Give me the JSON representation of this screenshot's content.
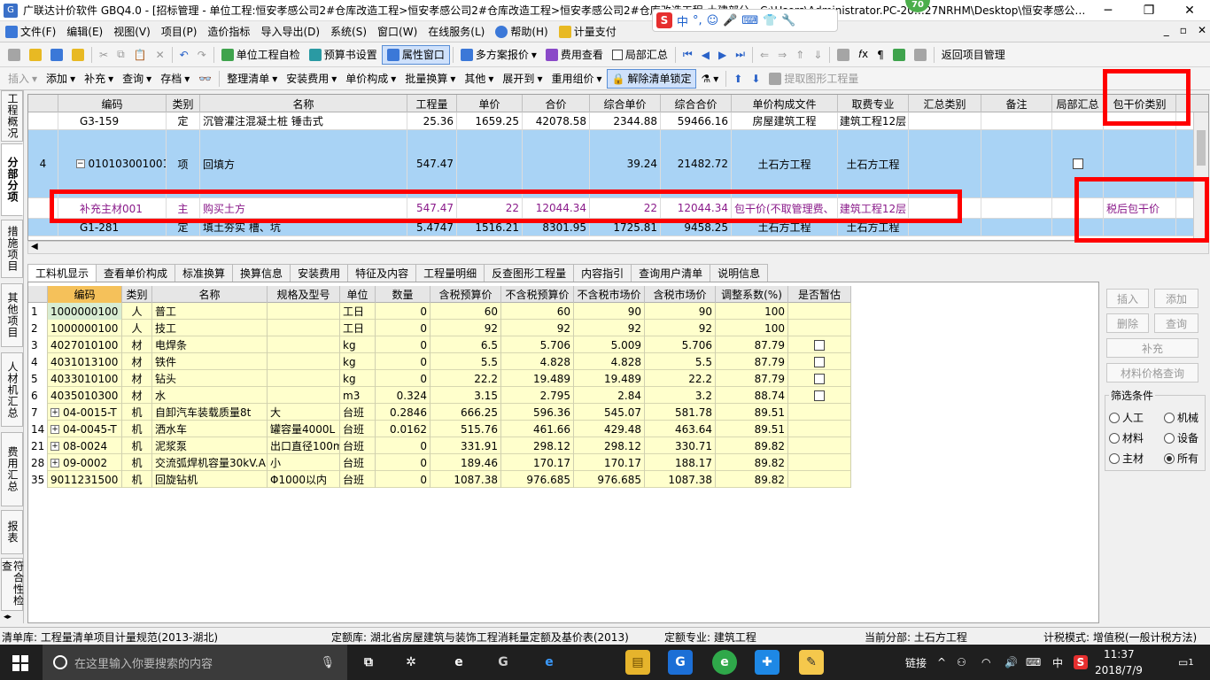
{
  "window": {
    "title": "广联达计价软件 GBQ4.0 - [招标管理 - 单位工程:恒安孝感公司2#仓库改造工程>恒安孝感公司2#仓库改造工程>恒安孝感公司2#仓库改造工程-土建部分 - C:\\Users\\Administrator.PC-20…27NRHM\\Desktop\\恒安孝感公…",
    "minimize": "─",
    "restore": "❐",
    "close": "✕"
  },
  "ime": {
    "logo": "S",
    "mode": "中",
    "punct": "°,"
  },
  "badge": "70",
  "menu": {
    "items": [
      "文件(F)",
      "编辑(E)",
      "视图(V)",
      "项目(P)",
      "造价指标",
      "导入导出(D)",
      "系统(S)",
      "窗口(W)",
      "在线服务(L)",
      "帮助(H)",
      "计量支付"
    ],
    "right": [
      "_",
      "▫",
      "✕"
    ]
  },
  "toolbar1": {
    "self_check": "单位工程自检",
    "budget_setting": "预算书设置",
    "attr_window": "属性窗口",
    "multi_quote": "多方案报价",
    "fee_view": "费用查看",
    "local_summary": "局部汇总",
    "return_project": "返回项目管理"
  },
  "toolbar2": {
    "items": [
      "插入",
      "添加",
      "补充",
      "查询",
      "存档"
    ],
    "items2": [
      "整理清单",
      "安装费用",
      "单价构成",
      "批量换算",
      "其他",
      "展开到",
      "重用组价"
    ],
    "unlock": "解除清单锁定",
    "extract": "提取图形工程量"
  },
  "lefttabs": [
    "工程概况",
    "分部分项",
    "措施项目",
    "其他项目",
    "人材机汇总",
    "费用汇总",
    "报表",
    "符合性检查"
  ],
  "grid1": {
    "columns": [
      "编码",
      "类别",
      "名称",
      "工程量",
      "单价",
      "合价",
      "综合单价",
      "综合合价",
      "单价构成文件",
      "取费专业",
      "汇总类别",
      "备注",
      "局部汇总",
      "包干价类别"
    ],
    "rows": [
      {
        "idx": "",
        "code": "G3-159",
        "type": "定",
        "name": "沉管灌注混凝土桩 锤击式",
        "qty": "25.36",
        "price": "1659.25",
        "total": "42078.58",
        "uprice": "2344.88",
        "utotal": "59466.16",
        "file": "房屋建筑工程",
        "major": "建筑工程12层",
        "pkg": ""
      },
      {
        "idx": "4",
        "code": "010103001001",
        "type": "项",
        "name": "回填方",
        "qty": "547.47",
        "price": "",
        "total": "",
        "uprice": "39.24",
        "utotal": "21482.72",
        "file": "土石方工程",
        "major": "土石方工程",
        "pkg": ""
      },
      {
        "idx": "",
        "code": "补充主材001",
        "type": "主",
        "name": "购买土方",
        "qty": "547.47",
        "price": "22",
        "total": "12044.34",
        "uprice": "22",
        "utotal": "12044.34",
        "file": "包干价(不取管理费、",
        "major": "建筑工程12层",
        "pkg": "税后包干价"
      },
      {
        "idx": "",
        "code": "G1-281",
        "type": "定",
        "name": "填土夯实 槽、坑",
        "qty": "5.4747",
        "price": "1516.21",
        "total": "8301.95",
        "uprice": "1725.81",
        "utotal": "9458.25",
        "file": "土石方工程",
        "major": "土石方工程",
        "pkg": ""
      }
    ]
  },
  "subtabs": [
    "工料机显示",
    "查看单价构成",
    "标准换算",
    "换算信息",
    "安装费用",
    "特征及内容",
    "工程量明细",
    "反查图形工程量",
    "内容指引",
    "查询用户清单",
    "说明信息"
  ],
  "grid2": {
    "columns": [
      "编码",
      "类别",
      "名称",
      "规格及型号",
      "单位",
      "数量",
      "含税预算价",
      "不含税预算价",
      "不含税市场价",
      "含税市场价",
      "调整系数(%)",
      "是否暂估"
    ],
    "rows": [
      {
        "n": "1",
        "plus": false,
        "code": "1000000100",
        "type": "人",
        "name": "普工",
        "spec": "",
        "unit": "工日",
        "qty": "0",
        "p1": "60",
        "p2": "60",
        "p3": "90",
        "p4": "90",
        "coef": "100",
        "chk": false
      },
      {
        "n": "2",
        "plus": false,
        "code": "1000000100",
        "type": "人",
        "name": "技工",
        "spec": "",
        "unit": "工日",
        "qty": "0",
        "p1": "92",
        "p2": "92",
        "p3": "92",
        "p4": "92",
        "coef": "100",
        "chk": false
      },
      {
        "n": "3",
        "plus": false,
        "code": "4027010100",
        "type": "材",
        "name": "电焊条",
        "spec": "",
        "unit": "kg",
        "qty": "0",
        "p1": "6.5",
        "p2": "5.706",
        "p3": "5.009",
        "p4": "5.706",
        "coef": "87.79",
        "chk": true
      },
      {
        "n": "4",
        "plus": false,
        "code": "4031013100",
        "type": "材",
        "name": "铁件",
        "spec": "",
        "unit": "kg",
        "qty": "0",
        "p1": "5.5",
        "p2": "4.828",
        "p3": "4.828",
        "p4": "5.5",
        "coef": "87.79",
        "chk": true
      },
      {
        "n": "5",
        "plus": false,
        "code": "4033010100",
        "type": "材",
        "name": "钻头",
        "spec": "",
        "unit": "kg",
        "qty": "0",
        "p1": "22.2",
        "p2": "19.489",
        "p3": "19.489",
        "p4": "22.2",
        "coef": "87.79",
        "chk": true
      },
      {
        "n": "6",
        "plus": false,
        "code": "4035010300",
        "type": "材",
        "name": "水",
        "spec": "",
        "unit": "m3",
        "qty": "0.324",
        "p1": "3.15",
        "p2": "2.795",
        "p3": "2.84",
        "p4": "3.2",
        "coef": "88.74",
        "chk": true
      },
      {
        "n": "7",
        "plus": true,
        "code": "04-0015-T",
        "type": "机",
        "name": "自卸汽车装载质量8t",
        "spec": "大",
        "unit": "台班",
        "qty": "0.2846",
        "p1": "666.25",
        "p2": "596.36",
        "p3": "545.07",
        "p4": "581.78",
        "coef": "89.51",
        "chk": false
      },
      {
        "n": "14",
        "plus": true,
        "code": "04-0045-T",
        "type": "机",
        "name": "洒水车",
        "spec": "罐容量4000L",
        "unit": "台班",
        "qty": "0.0162",
        "p1": "515.76",
        "p2": "461.66",
        "p3": "429.48",
        "p4": "463.64",
        "coef": "89.51",
        "chk": false
      },
      {
        "n": "21",
        "plus": true,
        "code": "08-0024",
        "type": "机",
        "name": "泥浆泵",
        "spec": "出口直径100m",
        "unit": "台班",
        "qty": "0",
        "p1": "331.91",
        "p2": "298.12",
        "p3": "298.12",
        "p4": "330.71",
        "coef": "89.82",
        "chk": false
      },
      {
        "n": "28",
        "plus": true,
        "code": "09-0002",
        "type": "机",
        "name": "交流弧焊机容量30kV.A",
        "spec": "小",
        "unit": "台班",
        "qty": "0",
        "p1": "189.46",
        "p2": "170.17",
        "p3": "170.17",
        "p4": "188.17",
        "coef": "89.82",
        "chk": false
      },
      {
        "n": "35",
        "plus": false,
        "code": "9011231500",
        "type": "机",
        "name": "回旋钻机",
        "spec": "Φ1000以内",
        "unit": "台班",
        "qty": "0",
        "p1": "1087.38",
        "p2": "976.685",
        "p3": "976.685",
        "p4": "1087.38",
        "coef": "89.82",
        "chk": false
      }
    ]
  },
  "rightpanel": {
    "insert": "插入",
    "add": "添加",
    "delete": "删除",
    "query": "查询",
    "supplement": "补充",
    "price_query": "材料价格查询",
    "filter_title": "筛选条件",
    "filters": [
      "人工",
      "机械",
      "材料",
      "设备",
      "主材",
      "所有"
    ],
    "filter_selected": "所有"
  },
  "status": {
    "list_lib": "清单库:  工程量清单项目计量规范(2013-湖北)",
    "quota_lib": "定额库:  湖北省房屋建筑与装饰工程消耗量定额及基价表(2013)",
    "quota_major": "定额专业:  建筑工程",
    "current_part": "当前分部:  土石方工程",
    "tax_mode": "计税模式:  增值税(一般计税方法)"
  },
  "taskbar": {
    "search_placeholder": "在这里输入你要搜索的内容",
    "tray_link": "链接",
    "ime": "中",
    "time": "11:37",
    "date": "2018/7/9",
    "notif": "1"
  },
  "colors": {
    "highlight_row": "#a9d3f5",
    "material_yellow": "#ffffcc",
    "annotation_red": "#ff0000"
  }
}
